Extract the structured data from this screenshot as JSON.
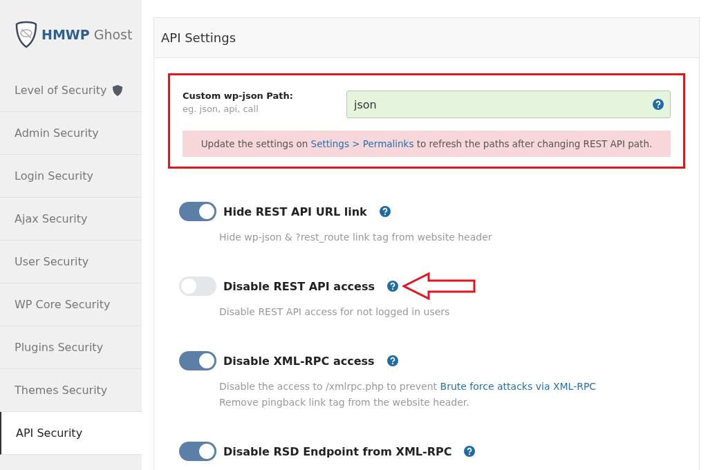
{
  "sidebar": {
    "logo": {
      "brand": "HMWP",
      "product": "Ghost"
    },
    "items": [
      {
        "label": "Level of Security",
        "badge_icon": true,
        "selected": false
      },
      {
        "label": "Admin Security",
        "badge_icon": false,
        "selected": false
      },
      {
        "label": "Login Security",
        "badge_icon": false,
        "selected": false
      },
      {
        "label": "Ajax Security",
        "badge_icon": false,
        "selected": false
      },
      {
        "label": "User Security",
        "badge_icon": false,
        "selected": false
      },
      {
        "label": "WP Core Security",
        "badge_icon": false,
        "selected": false
      },
      {
        "label": "Plugins Security",
        "badge_icon": false,
        "selected": false
      },
      {
        "label": "Themes Security",
        "badge_icon": false,
        "selected": false
      },
      {
        "label": "API Security",
        "badge_icon": false,
        "selected": true
      }
    ]
  },
  "panel": {
    "title": "API Settings",
    "path_field": {
      "label": "Custom wp-json Path:",
      "hint": "eg. json, api, call",
      "value": "json"
    },
    "notice": [
      {
        "kind": "text",
        "text": "Update the settings on "
      },
      {
        "kind": "link",
        "text": "Settings > Permalinks"
      },
      {
        "kind": "text",
        "text": " to refresh the paths after changing REST API path."
      }
    ],
    "options": [
      {
        "label": "Hide REST API URL link",
        "on": true,
        "description": [
          [
            {
              "kind": "text",
              "text": "Hide wp-json & ?rest_route link tag from website header"
            }
          ]
        ]
      },
      {
        "label": "Disable REST API access",
        "on": false,
        "description": [
          [
            {
              "kind": "text",
              "text": "Disable REST API access for not logged in users"
            }
          ]
        ]
      },
      {
        "label": "Disable XML-RPC access",
        "on": true,
        "description": [
          [
            {
              "kind": "text",
              "text": "Disable the access to /xmlrpc.php to prevent "
            },
            {
              "kind": "link",
              "text": "Brute force attacks via XML-RPC"
            }
          ],
          [
            {
              "kind": "text",
              "text": "Remove pingback link tag from the website header."
            }
          ]
        ]
      },
      {
        "label": "Disable RSD Endpoint from XML-RPC",
        "on": true
      }
    ]
  }
}
